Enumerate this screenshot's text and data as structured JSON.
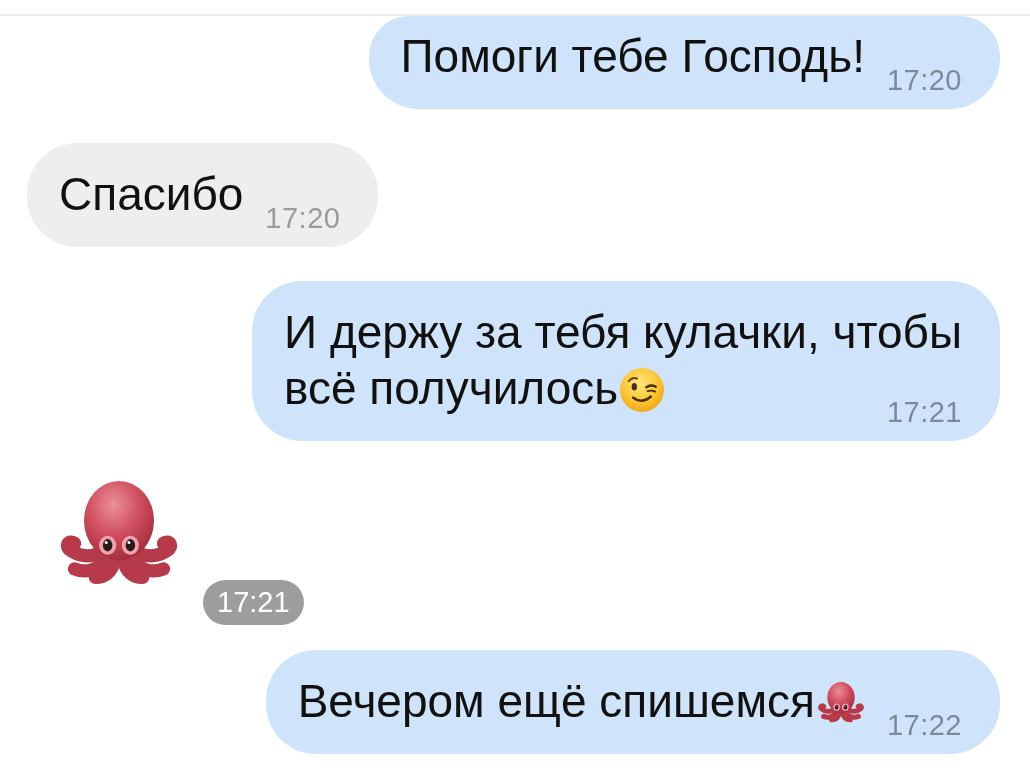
{
  "chat": {
    "messages": [
      {
        "kind": "text",
        "outgoing": true,
        "lines": [
          "Помоги тебе Господь!"
        ],
        "time": "17:20"
      },
      {
        "kind": "text",
        "outgoing": false,
        "lines": [
          "Спасибо"
        ],
        "time": "17:20"
      },
      {
        "kind": "text",
        "outgoing": true,
        "lines": [
          "И держу за тебя кулачки, чтобы",
          "всё получилось"
        ],
        "emoji": {
          "kind": "wink"
        },
        "time": "17:21"
      },
      {
        "kind": "sticker",
        "outgoing": false,
        "sticker": {
          "kind": "octopus"
        },
        "time": "17:21"
      },
      {
        "kind": "text",
        "outgoing": true,
        "lines": [
          "Вечером ещё спишемся"
        ],
        "emoji": {
          "kind": "octopus"
        },
        "time": "17:22"
      }
    ]
  }
}
